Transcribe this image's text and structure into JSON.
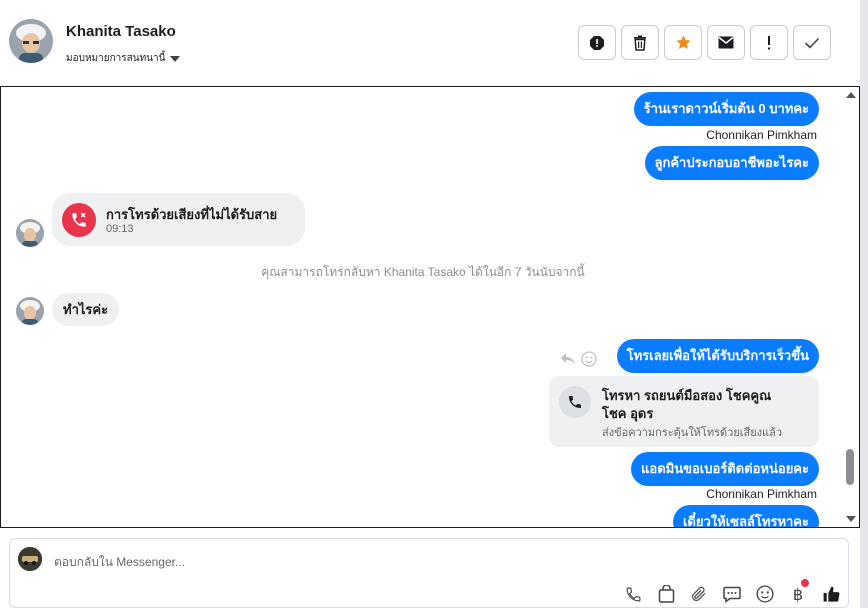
{
  "header": {
    "contact_name": "Khanita Tasako",
    "assign_label": "มอบหมายการสนทนานี้",
    "actions": [
      {
        "icon": "alert-circle-icon"
      },
      {
        "icon": "trash-icon"
      },
      {
        "icon": "star-icon",
        "color": "#f28b1e"
      },
      {
        "icon": "mail-icon"
      },
      {
        "icon": "exclamation-icon"
      },
      {
        "icon": "check-icon"
      }
    ]
  },
  "chat": {
    "messages": {
      "m1": "ร้านเราดาวน์เริ่มต้น 0 บาทคะ",
      "sender1": "Chonnikan Pimkham",
      "m2": "ลูกค้าประกอบอาชีพอะไรคะ",
      "missed_call_title": "การโทรด้วยเสียงที่ไม่ได้รับสาย",
      "missed_call_time": "09:13",
      "system_note": "คุณสามารถโทรกลับหา Khanita Tasako ได้ในอีก 7 วันนับจากนี้",
      "m3": "ทำไรค่ะ",
      "m4": "โทรเลยเพื่อให้ได้รับบริการเร็วขึ้น",
      "call_card_title_line1": "โทรหา รถยนต์มือสอง โชคคูณ",
      "call_card_title_line2": "โชค อุดร",
      "call_card_subtitle": "ส่งข้อความกระตุ้นให้โทรด้วยเสียงแล้ว",
      "m5": "แอดมินขอเบอร์ติดต่อหน่อยคะ",
      "sender2": "Chonnikan Pimkham",
      "m6": "เดี๋ยวให้เซลล์โทรหาคะ"
    }
  },
  "composer": {
    "placeholder": "ตอบกลับใน Messenger...",
    "tools": [
      "phone-icon",
      "shopping-bag-icon",
      "paperclip-icon",
      "quick-reply-icon",
      "emoji-icon",
      "baht-icon",
      "thumbs-up-icon"
    ]
  },
  "colors": {
    "accent": "#0a7cff",
    "missed_call": "#e9344c",
    "star": "#f28b1e"
  }
}
